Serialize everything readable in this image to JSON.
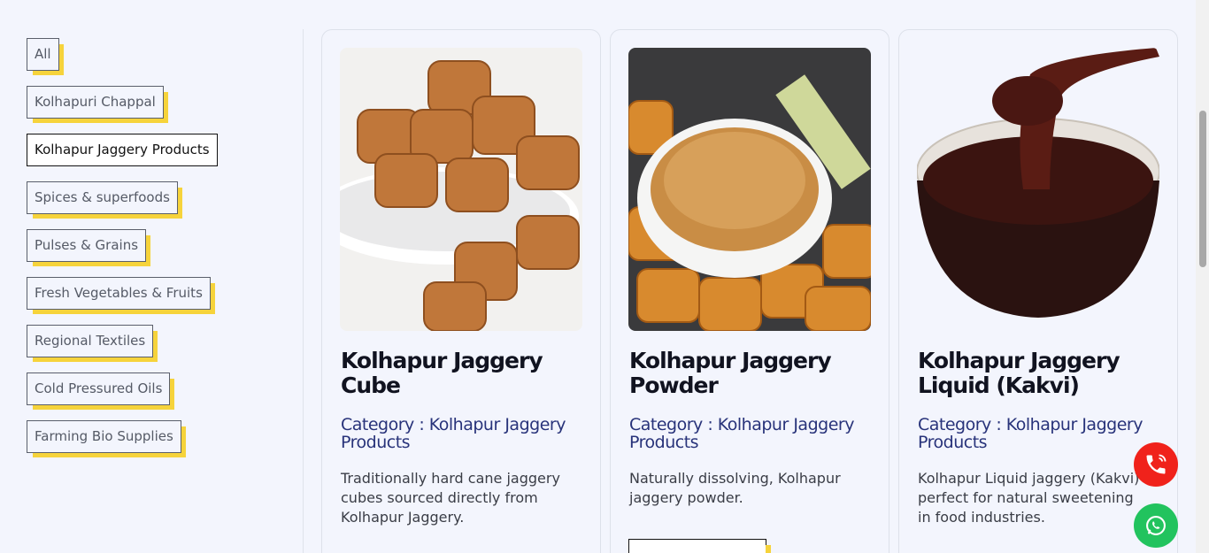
{
  "categories": [
    {
      "label": "All",
      "active": false
    },
    {
      "label": "Kolhapuri Chappal",
      "active": false
    },
    {
      "label": "Kolhapur Jaggery Products",
      "active": true
    },
    {
      "label": "Spices & superfoods",
      "active": false
    },
    {
      "label": "Pulses & Grains",
      "active": false
    },
    {
      "label": "Fresh Vegetables & Fruits",
      "active": false
    },
    {
      "label": "Regional Textiles",
      "active": false
    },
    {
      "label": "Cold Pressured Oils",
      "active": false
    },
    {
      "label": "Farming Bio Supplies",
      "active": false
    }
  ],
  "products": [
    {
      "title": "Kolhapur Jaggery Cube",
      "category_text": "Category : Kolhapur Jaggery Products",
      "description": "Traditionally hard cane jaggery cubes sourced directly from Kolhapur Jaggery.",
      "image": "jaggery-cubes-image"
    },
    {
      "title": "Kolhapur Jaggery Powder",
      "category_text": "Category : Kolhapur Jaggery Products",
      "description": "Naturally dissolving, Kolhapur jaggery powder.",
      "image": "jaggery-powder-image"
    },
    {
      "title": "Kolhapur Jaggery Liquid (Kakvi)",
      "category_text": "Category : Kolhapur Jaggery Products",
      "description": "Kolhapur Liquid jaggery (Kakvi) perfect for natural sweetening in food industries.",
      "image": "jaggery-liquid-image"
    }
  ],
  "floating": {
    "call_icon": "phone-icon",
    "whatsapp_icon": "whatsapp-icon",
    "call_color": "#f0221b",
    "whatsapp_color": "#22c35e"
  },
  "colors": {
    "accent_yellow": "#f6d33b",
    "category_blue": "#28337a",
    "background": "#f3f5fd"
  }
}
